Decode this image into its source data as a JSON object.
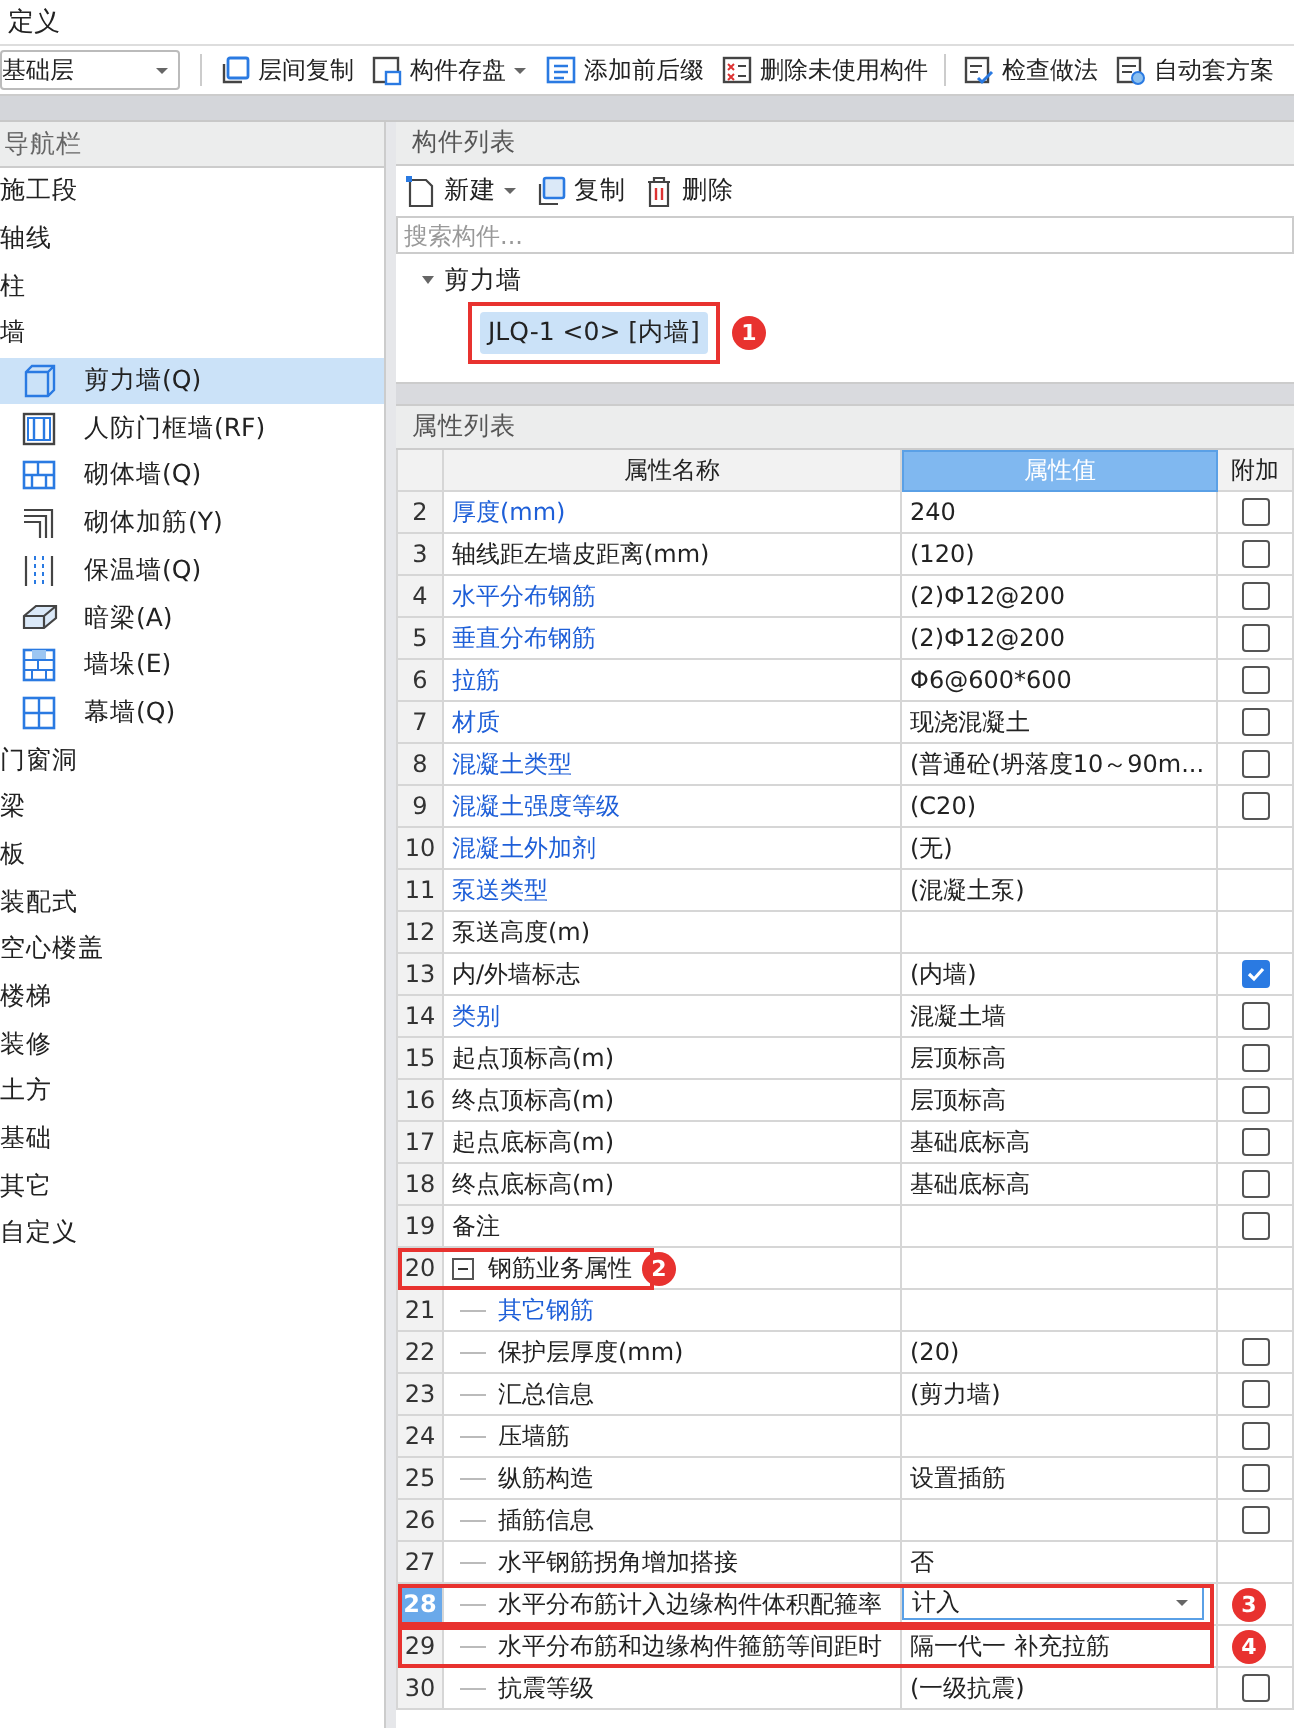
{
  "menu": {
    "label": "定义"
  },
  "toolbar": {
    "floor": "基础层",
    "buttons": [
      {
        "label": "层间复制",
        "has_menu": false
      },
      {
        "label": "构件存盘",
        "has_menu": true
      },
      {
        "label": "添加前后缀",
        "has_menu": false
      },
      {
        "label": "删除未使用构件",
        "has_menu": false
      },
      {
        "label": "检查做法",
        "has_menu": false
      },
      {
        "label": "自动套方案",
        "has_menu": false
      }
    ]
  },
  "nav": {
    "title": "导航栏",
    "items": [
      {
        "label": "施工段"
      },
      {
        "label": "轴线"
      },
      {
        "label": "柱"
      },
      {
        "label": "墙",
        "children": [
          {
            "label": "剪力墙(Q)",
            "selected": true
          },
          {
            "label": "人防门框墙(RF)",
            "selected": false
          },
          {
            "label": "砌体墙(Q)",
            "selected": false
          },
          {
            "label": "砌体加筋(Y)",
            "selected": false
          },
          {
            "label": "保温墙(Q)",
            "selected": false
          },
          {
            "label": "暗梁(A)",
            "selected": false
          },
          {
            "label": "墙垛(E)",
            "selected": false
          },
          {
            "label": "幕墙(Q)",
            "selected": false
          }
        ]
      },
      {
        "label": "门窗洞"
      },
      {
        "label": "梁"
      },
      {
        "label": "板"
      },
      {
        "label": "装配式"
      },
      {
        "label": "空心楼盖"
      },
      {
        "label": "楼梯"
      },
      {
        "label": "装修"
      },
      {
        "label": "土方"
      },
      {
        "label": "基础"
      },
      {
        "label": "其它"
      },
      {
        "label": "自定义"
      }
    ]
  },
  "component_list": {
    "title": "构件列表",
    "actions": [
      {
        "label": "新建",
        "has_menu": true
      },
      {
        "label": "复制",
        "has_menu": false
      },
      {
        "label": "删除",
        "has_menu": false
      }
    ],
    "search": {
      "placeholder": "搜索构件..."
    },
    "tree": [
      {
        "label": "剪力墙",
        "expanded": true,
        "children": [
          {
            "label": "JLQ-1 <0> [内墙]",
            "selected": true,
            "callout": "1"
          }
        ]
      }
    ]
  },
  "properties": {
    "title": "属性列表",
    "columns": [
      {
        "label": "属性名称",
        "selected": false
      },
      {
        "label": "属性值",
        "selected": true
      },
      {
        "label": "附加",
        "selected": false
      }
    ],
    "rows": [
      {
        "number": "2",
        "name": "厚度(mm)",
        "value": "240",
        "public": true,
        "kind": "text",
        "selected": false,
        "checked": false
      },
      {
        "number": "3",
        "name": "轴线距左墙皮距离(mm)",
        "value": "(120)",
        "public": false,
        "kind": "text",
        "selected": false,
        "checked": false
      },
      {
        "number": "4",
        "name": "水平分布钢筋",
        "value": "(2)Ф12@200",
        "public": true,
        "kind": "text",
        "selected": false,
        "checked": false
      },
      {
        "number": "5",
        "name": "垂直分布钢筋",
        "value": "(2)Ф12@200",
        "public": true,
        "kind": "text",
        "selected": false,
        "checked": false
      },
      {
        "number": "6",
        "name": "拉筋",
        "value": "Φ6@600*600",
        "public": true,
        "kind": "text",
        "selected": false,
        "checked": false
      },
      {
        "number": "7",
        "name": "材质",
        "value": "现浇混凝土",
        "public": true,
        "kind": "text",
        "selected": false,
        "checked": false
      },
      {
        "number": "8",
        "name": "混凝土类型",
        "value": "(普通砼(坍落度10～90m...",
        "public": true,
        "kind": "text",
        "selected": false,
        "checked": false
      },
      {
        "number": "9",
        "name": "混凝土强度等级",
        "value": "(C20)",
        "public": true,
        "kind": "text",
        "selected": false,
        "checked": false
      },
      {
        "number": "10",
        "name": "混凝土外加剂",
        "value": "(无)",
        "public": true,
        "kind": "text",
        "selected": false
      },
      {
        "number": "11",
        "name": "泵送类型",
        "value": "(混凝土泵)",
        "public": true,
        "kind": "text",
        "selected": false
      },
      {
        "number": "12",
        "name": "泵送高度(m)",
        "public": false,
        "kind": "text",
        "selected": false
      },
      {
        "number": "13",
        "name": "内/外墙标志",
        "value": "(内墙)",
        "public": false,
        "kind": "text",
        "selected": false,
        "checked": true
      },
      {
        "number": "14",
        "name": "类别",
        "value": "混凝土墙",
        "public": true,
        "kind": "text",
        "selected": false,
        "checked": false
      },
      {
        "number": "15",
        "name": "起点顶标高(m)",
        "value": "层顶标高",
        "public": false,
        "kind": "text",
        "selected": false,
        "checked": false
      },
      {
        "number": "16",
        "name": "终点顶标高(m)",
        "value": "层顶标高",
        "public": false,
        "kind": "text",
        "selected": false,
        "checked": false
      },
      {
        "number": "17",
        "name": "起点底标高(m)",
        "value": "基础底标高",
        "public": false,
        "kind": "text",
        "selected": false,
        "checked": false
      },
      {
        "number": "18",
        "name": "终点底标高(m)",
        "value": "基础底标高",
        "public": false,
        "kind": "text",
        "selected": false,
        "checked": false
      },
      {
        "number": "19",
        "name": "备注",
        "public": false,
        "kind": "text",
        "selected": false,
        "checked": false
      },
      {
        "number": "20",
        "name": "钢筋业务属性",
        "public": false,
        "kind": "text",
        "selected": false,
        "expanded": true,
        "callout": "2",
        "children": [
          {
            "number": "21",
            "name": "其它钢筋",
            "public": true,
            "kind": "text",
            "selected": false
          },
          {
            "number": "22",
            "name": "保护层厚度(mm)",
            "value": "(20)",
            "public": false,
            "kind": "text",
            "selected": false,
            "checked": false
          },
          {
            "number": "23",
            "name": "汇总信息",
            "value": "(剪力墙)",
            "public": false,
            "kind": "text",
            "selected": false,
            "checked": false
          },
          {
            "number": "24",
            "name": "压墙筋",
            "public": false,
            "kind": "text",
            "selected": false,
            "checked": false
          },
          {
            "number": "25",
            "name": "纵筋构造",
            "value": "设置插筋",
            "public": false,
            "kind": "text",
            "selected": false,
            "checked": false
          },
          {
            "number": "26",
            "name": "插筋信息",
            "public": false,
            "kind": "text",
            "selected": false,
            "checked": false
          },
          {
            "number": "27",
            "name": "水平钢筋拐角增加搭接",
            "value": "否",
            "public": false,
            "kind": "text",
            "selected": false
          },
          {
            "number": "28",
            "name": "水平分布筋计入边缘构件体积配箍率",
            "value": "计入",
            "public": false,
            "kind": "dropdown",
            "selected": true,
            "callout": "3"
          },
          {
            "number": "29",
            "name": "水平分布筋和边缘构件箍筋等间距时",
            "value": "隔一代一  补充拉筋",
            "public": false,
            "kind": "text",
            "selected": false,
            "callout": "4"
          },
          {
            "number": "30",
            "name": "抗震等级",
            "value": "(一级抗震)",
            "public": false,
            "kind": "text",
            "selected": false,
            "checked": false
          }
        ]
      }
    ]
  }
}
